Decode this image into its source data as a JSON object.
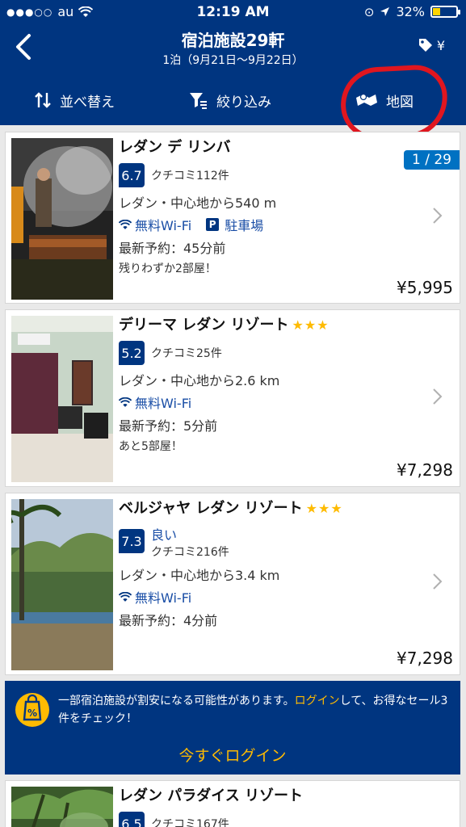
{
  "status": {
    "carrier": "au",
    "time": "12:19 AM",
    "battery": "32%",
    "battery_level": 0.32
  },
  "header": {
    "title": "宿泊施設29軒",
    "subtitle": "1泊（9月21日〜9月22日）",
    "currency": "¥"
  },
  "toolbar": {
    "sort": "並べ替え",
    "filter": "絞り込み",
    "map": "地図"
  },
  "hotels": [
    {
      "name": "レダン デ リンバ",
      "stars": "",
      "score": "6.7",
      "score_word": "",
      "reviews": "クチコミ112件",
      "distance": "レダン・中心地から540 m",
      "wifi": "無料Wi-Fi",
      "parking": "駐車場",
      "booked": "最新予約：45分前",
      "rooms_left": "残りわずか2部屋！",
      "price": "¥5,995",
      "counter": "1 / 29"
    },
    {
      "name": "デリーマ レダン リゾート",
      "stars": "★★★",
      "score": "5.2",
      "reviews": "クチコミ25件",
      "distance": "レダン・中心地から2.6 km",
      "wifi": "無料Wi-Fi",
      "booked": "最新予約：5分前",
      "rooms_left": "あと5部屋！",
      "price": "¥7,298"
    },
    {
      "name": "ベルジャヤ レダン リゾート",
      "stars": "★★★",
      "score": "7.3",
      "score_word": "良い",
      "reviews": "クチコミ216件",
      "distance": "レダン・中心地から3.4 km",
      "wifi": "無料Wi-Fi",
      "booked": "最新予約：4分前",
      "price": "¥7,298"
    },
    {
      "name": "レダン パラダイス リゾート",
      "score": "6.5",
      "reviews": "クチコミ167件"
    }
  ],
  "banner": {
    "text_before": "一部宿泊施設が割安になる可能性があります。",
    "link": "ログイン",
    "text_after": "して、お得なセール3件をチェック！",
    "cta": "今すぐログイン"
  },
  "colors": {
    "brand": "#003580",
    "accent": "#febb02",
    "link": "#1a4ea6",
    "highlight": "#e0161f"
  }
}
